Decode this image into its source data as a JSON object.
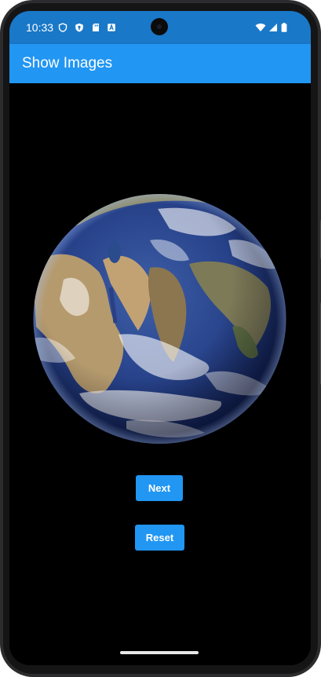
{
  "status_bar": {
    "time": "10:33",
    "left_icons": [
      "shield-icon",
      "vpn-key-icon",
      "sd-card-icon",
      "a-box-icon"
    ],
    "right_icons": [
      "wifi-icon",
      "signal-icon",
      "battery-icon"
    ],
    "background": "#1a78c8"
  },
  "app_bar": {
    "title": "Show Images",
    "background": "#2196f3"
  },
  "content": {
    "image_icon": "earth-globe-image",
    "background": "#000000"
  },
  "buttons": {
    "next_label": "Next",
    "reset_label": "Reset",
    "color": "#2196f3"
  }
}
